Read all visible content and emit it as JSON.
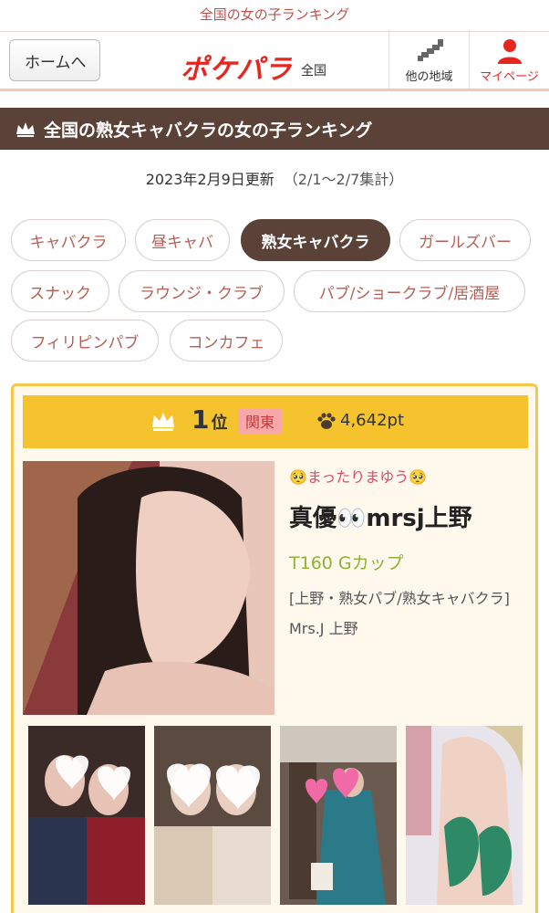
{
  "top_caption": "全国の女の子ランキング",
  "header": {
    "home_label": "ホームへ",
    "logo_text": "ポケパラ",
    "region_label": "全国",
    "other_area_label": "他の地域",
    "mypage_label": "マイページ",
    "icons": {
      "other_area": "map-icon",
      "mypage": "person-icon"
    }
  },
  "section": {
    "title": "全国の熟女キャバクラの女の子ランキング",
    "icon": "crown-icon"
  },
  "updated": {
    "date": "2023年2月9日更新",
    "period": "（2/1〜2/7集計）"
  },
  "categories": [
    {
      "label": "キャバクラ",
      "active": false
    },
    {
      "label": "昼キャバ",
      "active": false
    },
    {
      "label": "熟女キャバクラ",
      "active": true
    },
    {
      "label": "ガールズバー",
      "active": false
    },
    {
      "label": "スナック",
      "active": false
    },
    {
      "label": "ラウンジ・クラブ",
      "active": false
    },
    {
      "label": "パブ/ショークラブ/居酒屋",
      "active": false
    },
    {
      "label": "フィリピンパブ",
      "active": false
    },
    {
      "label": "コンカフェ",
      "active": false
    }
  ],
  "ranking": {
    "rank": "1",
    "rank_suffix": "位",
    "region": "関東",
    "points": "4,642pt",
    "catchphrase": "🥺まったりまゆう🥺",
    "name": "真優👀mrsj上野",
    "spec": "T160 Gカップ",
    "shop_type": "[上野・熟女パブ/熟女キャバクラ]",
    "shop_name": "Mrs.J 上野"
  },
  "colors": {
    "accent_red": "#e8261f",
    "header_brown": "#5a4238",
    "rank_gold": "#f4c32e",
    "spec_green": "#8cb33a"
  }
}
